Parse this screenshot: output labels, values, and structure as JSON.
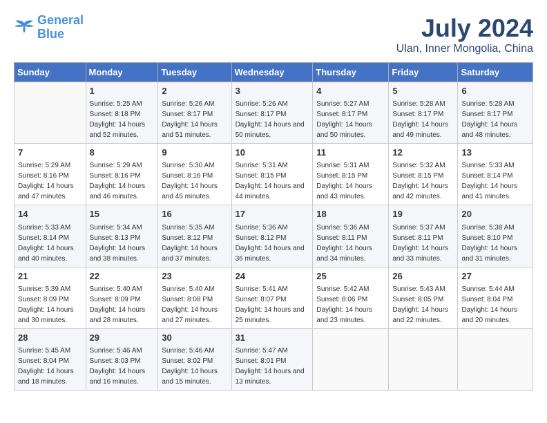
{
  "header": {
    "logo_line1": "General",
    "logo_line2": "Blue",
    "month_title": "July 2024",
    "location": "Ulan, Inner Mongolia, China"
  },
  "weekdays": [
    "Sunday",
    "Monday",
    "Tuesday",
    "Wednesday",
    "Thursday",
    "Friday",
    "Saturday"
  ],
  "weeks": [
    [
      {
        "num": "",
        "sunrise": "",
        "sunset": "",
        "daylight": "",
        "empty": true
      },
      {
        "num": "1",
        "sunrise": "Sunrise: 5:25 AM",
        "sunset": "Sunset: 8:18 PM",
        "daylight": "Daylight: 14 hours and 52 minutes."
      },
      {
        "num": "2",
        "sunrise": "Sunrise: 5:26 AM",
        "sunset": "Sunset: 8:17 PM",
        "daylight": "Daylight: 14 hours and 51 minutes."
      },
      {
        "num": "3",
        "sunrise": "Sunrise: 5:26 AM",
        "sunset": "Sunset: 8:17 PM",
        "daylight": "Daylight: 14 hours and 50 minutes."
      },
      {
        "num": "4",
        "sunrise": "Sunrise: 5:27 AM",
        "sunset": "Sunset: 8:17 PM",
        "daylight": "Daylight: 14 hours and 50 minutes."
      },
      {
        "num": "5",
        "sunrise": "Sunrise: 5:28 AM",
        "sunset": "Sunset: 8:17 PM",
        "daylight": "Daylight: 14 hours and 49 minutes."
      },
      {
        "num": "6",
        "sunrise": "Sunrise: 5:28 AM",
        "sunset": "Sunset: 8:17 PM",
        "daylight": "Daylight: 14 hours and 48 minutes."
      }
    ],
    [
      {
        "num": "7",
        "sunrise": "Sunrise: 5:29 AM",
        "sunset": "Sunset: 8:16 PM",
        "daylight": "Daylight: 14 hours and 47 minutes."
      },
      {
        "num": "8",
        "sunrise": "Sunrise: 5:29 AM",
        "sunset": "Sunset: 8:16 PM",
        "daylight": "Daylight: 14 hours and 46 minutes."
      },
      {
        "num": "9",
        "sunrise": "Sunrise: 5:30 AM",
        "sunset": "Sunset: 8:16 PM",
        "daylight": "Daylight: 14 hours and 45 minutes."
      },
      {
        "num": "10",
        "sunrise": "Sunrise: 5:31 AM",
        "sunset": "Sunset: 8:15 PM",
        "daylight": "Daylight: 14 hours and 44 minutes."
      },
      {
        "num": "11",
        "sunrise": "Sunrise: 5:31 AM",
        "sunset": "Sunset: 8:15 PM",
        "daylight": "Daylight: 14 hours and 43 minutes."
      },
      {
        "num": "12",
        "sunrise": "Sunrise: 5:32 AM",
        "sunset": "Sunset: 8:15 PM",
        "daylight": "Daylight: 14 hours and 42 minutes."
      },
      {
        "num": "13",
        "sunrise": "Sunrise: 5:33 AM",
        "sunset": "Sunset: 8:14 PM",
        "daylight": "Daylight: 14 hours and 41 minutes."
      }
    ],
    [
      {
        "num": "14",
        "sunrise": "Sunrise: 5:33 AM",
        "sunset": "Sunset: 8:14 PM",
        "daylight": "Daylight: 14 hours and 40 minutes."
      },
      {
        "num": "15",
        "sunrise": "Sunrise: 5:34 AM",
        "sunset": "Sunset: 8:13 PM",
        "daylight": "Daylight: 14 hours and 38 minutes."
      },
      {
        "num": "16",
        "sunrise": "Sunrise: 5:35 AM",
        "sunset": "Sunset: 8:12 PM",
        "daylight": "Daylight: 14 hours and 37 minutes."
      },
      {
        "num": "17",
        "sunrise": "Sunrise: 5:36 AM",
        "sunset": "Sunset: 8:12 PM",
        "daylight": "Daylight: 14 hours and 36 minutes."
      },
      {
        "num": "18",
        "sunrise": "Sunrise: 5:36 AM",
        "sunset": "Sunset: 8:11 PM",
        "daylight": "Daylight: 14 hours and 34 minutes."
      },
      {
        "num": "19",
        "sunrise": "Sunrise: 5:37 AM",
        "sunset": "Sunset: 8:11 PM",
        "daylight": "Daylight: 14 hours and 33 minutes."
      },
      {
        "num": "20",
        "sunrise": "Sunrise: 5:38 AM",
        "sunset": "Sunset: 8:10 PM",
        "daylight": "Daylight: 14 hours and 31 minutes."
      }
    ],
    [
      {
        "num": "21",
        "sunrise": "Sunrise: 5:39 AM",
        "sunset": "Sunset: 8:09 PM",
        "daylight": "Daylight: 14 hours and 30 minutes."
      },
      {
        "num": "22",
        "sunrise": "Sunrise: 5:40 AM",
        "sunset": "Sunset: 8:09 PM",
        "daylight": "Daylight: 14 hours and 28 minutes."
      },
      {
        "num": "23",
        "sunrise": "Sunrise: 5:40 AM",
        "sunset": "Sunset: 8:08 PM",
        "daylight": "Daylight: 14 hours and 27 minutes."
      },
      {
        "num": "24",
        "sunrise": "Sunrise: 5:41 AM",
        "sunset": "Sunset: 8:07 PM",
        "daylight": "Daylight: 14 hours and 25 minutes."
      },
      {
        "num": "25",
        "sunrise": "Sunrise: 5:42 AM",
        "sunset": "Sunset: 8:06 PM",
        "daylight": "Daylight: 14 hours and 23 minutes."
      },
      {
        "num": "26",
        "sunrise": "Sunrise: 5:43 AM",
        "sunset": "Sunset: 8:05 PM",
        "daylight": "Daylight: 14 hours and 22 minutes."
      },
      {
        "num": "27",
        "sunrise": "Sunrise: 5:44 AM",
        "sunset": "Sunset: 8:04 PM",
        "daylight": "Daylight: 14 hours and 20 minutes."
      }
    ],
    [
      {
        "num": "28",
        "sunrise": "Sunrise: 5:45 AM",
        "sunset": "Sunset: 8:04 PM",
        "daylight": "Daylight: 14 hours and 18 minutes."
      },
      {
        "num": "29",
        "sunrise": "Sunrise: 5:46 AM",
        "sunset": "Sunset: 8:03 PM",
        "daylight": "Daylight: 14 hours and 16 minutes."
      },
      {
        "num": "30",
        "sunrise": "Sunrise: 5:46 AM",
        "sunset": "Sunset: 8:02 PM",
        "daylight": "Daylight: 14 hours and 15 minutes."
      },
      {
        "num": "31",
        "sunrise": "Sunrise: 5:47 AM",
        "sunset": "Sunset: 8:01 PM",
        "daylight": "Daylight: 14 hours and 13 minutes."
      },
      {
        "num": "",
        "sunrise": "",
        "sunset": "",
        "daylight": "",
        "empty": true
      },
      {
        "num": "",
        "sunrise": "",
        "sunset": "",
        "daylight": "",
        "empty": true
      },
      {
        "num": "",
        "sunrise": "",
        "sunset": "",
        "daylight": "",
        "empty": true
      }
    ]
  ]
}
